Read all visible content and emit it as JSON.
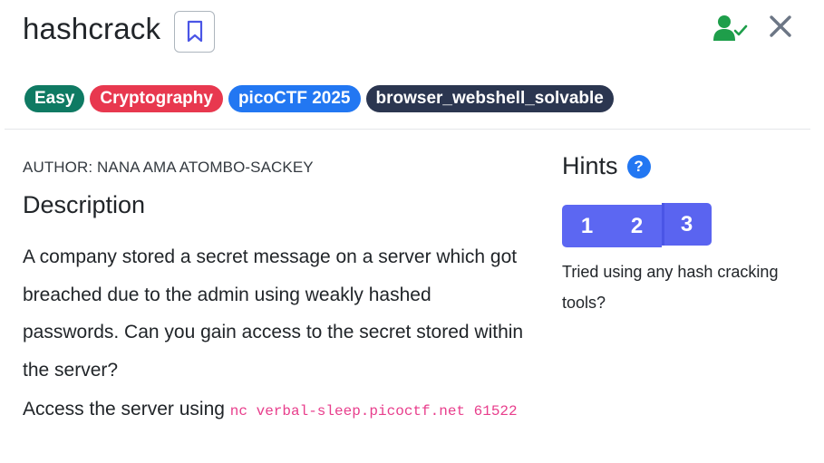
{
  "challenge": {
    "title": "hashcrack",
    "tags": [
      "Easy",
      "Cryptography",
      "picoCTF 2025",
      "browser_webshell_solvable"
    ]
  },
  "author": "AUTHOR: NANA AMA ATOMBO-SACKEY",
  "description": {
    "heading": "Description",
    "body": "A company stored a secret message on a server which got breached due to the admin using weakly hashed passwords. Can you gain access to the secret stored within the server?",
    "access_prefix": "Access the server using",
    "access_command": "nc verbal-sleep.picoctf.net 61522"
  },
  "hints": {
    "title": "Hints",
    "help_symbol": "?",
    "buttons": [
      "1",
      "2",
      "3"
    ],
    "selected": "3",
    "text": "Tried using any hash cracking tools?"
  },
  "colors": {
    "easy": "#0f7a63",
    "cryptography": "#e8384f",
    "event": "#2277f2",
    "webshell": "#2b3650",
    "hint_button": "#5c67f2",
    "user_check": "#1e9e4a",
    "code": "#e83e8c"
  },
  "icons": [
    "bookmark-icon",
    "user-check-icon",
    "close-icon",
    "help-icon"
  ]
}
